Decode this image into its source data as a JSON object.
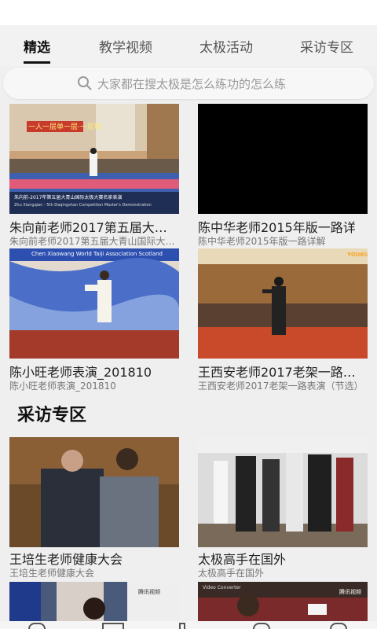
{
  "tabs": [
    {
      "label": "精选",
      "active": true
    },
    {
      "label": "教学视频",
      "active": false
    },
    {
      "label": "太极活动",
      "active": false
    },
    {
      "label": "采访专区",
      "active": false
    }
  ],
  "search": {
    "placeholder": "大家都在搜太极是怎么练功的怎么练",
    "icon": "search-icon"
  },
  "featured": [
    {
      "title": "朱向前老师2017第五届大…",
      "subtitle": "朱向前老师2017第五届大青山国际大…",
      "thumb_caption": "朱向前-2017年第五届大青山国际太极大赛名家表演",
      "thumb_caption_en": "Zhu Xiangqian - 5th Daqingshan Competition Master's Demonstration",
      "banner_text": "一人一层单一层·一层城"
    },
    {
      "title": "陈中华老师2015年版一路详",
      "subtitle": "陈中华老师2015年版一路详解"
    },
    {
      "title": "陈小旺老师表演_201810",
      "subtitle": "陈小旺老师表演_201810",
      "thumb_caption": "Chen Xiaowang World Taiji Association Scotland"
    },
    {
      "title": "王西安老师2017老架一路…",
      "subtitle": "王西安老师2017老架一路表演（节选）",
      "thumb_caption": "YOUKU"
    }
  ],
  "section": {
    "title": "采访专区"
  },
  "interviews": [
    {
      "title": "王培生老师健康大会",
      "subtitle": "王培生老师健康大会"
    },
    {
      "title": "太极高手在国外",
      "subtitle": "太极高手在国外"
    }
  ],
  "partial_row": [
    {
      "badge": "腾讯视频"
    },
    {
      "badge": "腾讯视频",
      "overlay": "Video Converter"
    }
  ],
  "colors": {
    "active_tab": "#111111",
    "background": "#efefef",
    "subtitle": "#777777"
  }
}
